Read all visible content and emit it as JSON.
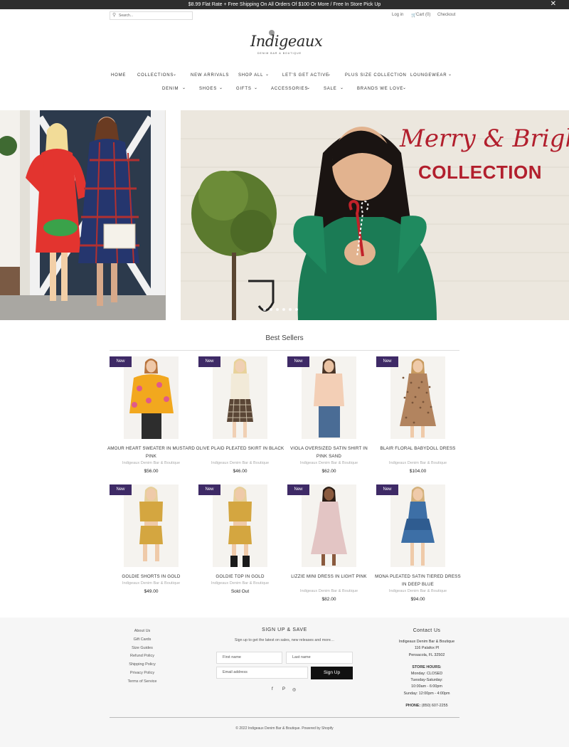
{
  "promo": {
    "text": "$8.99 Flat Rate + Free Shipping On All Orders Of $100 Or More / Free In Store Pick Up",
    "close": "✕"
  },
  "header": {
    "search_placeholder": "Search...",
    "login": "Log in",
    "cart": "Cart (0)",
    "checkout": "Checkout",
    "logo_text": "Indigeaux",
    "logo_sub": "DENIM BAR & BOUTIQUE"
  },
  "nav": {
    "row1": [
      "HOME",
      "COLLECTIONS",
      "NEW ARRIVALS",
      "SHOP ALL",
      "LET'S GET ACTIVE",
      "PLUS SIZE COLLECTION",
      "LOUNGEWEAR"
    ],
    "row2": [
      "DENIM",
      "SHOES",
      "GIFTS",
      "ACCESSORIES",
      "SALE",
      "BRANDS WE LOVE"
    ],
    "chevron": "⌄"
  },
  "hero": {
    "headline_script": "Merry & Bright",
    "headline_caps": "COLLECTION",
    "slides": 6,
    "active_slide": 1
  },
  "best_sellers": {
    "title": "Best Sellers",
    "badge": "New",
    "vendor": "Indigeaux Denim Bar & Boutique",
    "products": [
      {
        "name": "AMOUR HEART SWEATER IN MUSTARD PINK",
        "price": "$56.00"
      },
      {
        "name": "OLIVE PLAID PLEATED SKIRT IN BLACK",
        "price": "$46.00"
      },
      {
        "name": "VIOLA OVERSIZED SATIN SHIRT IN PINK SAND",
        "price": "$62.00"
      },
      {
        "name": "BLAIR FLORAL BABYDOLL DRESS",
        "price": "$104.00"
      },
      {
        "name": "GOLDIE SHORTS IN GOLD",
        "price": "$49.00"
      },
      {
        "name": "GOLDIE TOP IN GOLD",
        "price": "Sold Out"
      },
      {
        "name": "LIZZIE MINI DRESS IN LIGHT PINK",
        "price": "$82.00"
      },
      {
        "name": "MONA PLEATED SATIN TIERED DRESS IN DEEP BLUE",
        "price": "$94.00"
      }
    ]
  },
  "footer": {
    "links": [
      "About Us",
      "Gift Cards",
      "Size Guides",
      "Refund Policy",
      "Shipping Policy",
      "Privacy Policy",
      "Terms of Service"
    ],
    "signup": {
      "title": "SIGN UP & SAVE",
      "subtitle": "Sign up to get the latest on sales, new releases and more…",
      "first_name": "First name",
      "last_name": "Last name",
      "email": "Email address",
      "button": "Sign Up"
    },
    "social": [
      "f",
      "P",
      "◎"
    ],
    "contact": {
      "title": "Contact Us",
      "name": "Indigeaux Denim Bar & Boutique",
      "street": "116 Palafox Pl",
      "city": "Pensacola, FL 32502",
      "hours_title": "STORE HOURS:",
      "hours": [
        "Monday: CLOSED",
        "Tuesday-Saturday:",
        "10:00am - 6:00pm",
        "Sunday: 12:00pm - 4:00pm"
      ],
      "phone_label": "PHONE:",
      "phone": "(850) 607-2255"
    },
    "copyright": "© 2022 Indigeaux Denim Bar & Boutique. Powered by Shopify"
  },
  "colors": {
    "brand_red": "#b21f2d",
    "badge_purple": "#3e2a66",
    "promo_bg": "#2e2e2e"
  }
}
